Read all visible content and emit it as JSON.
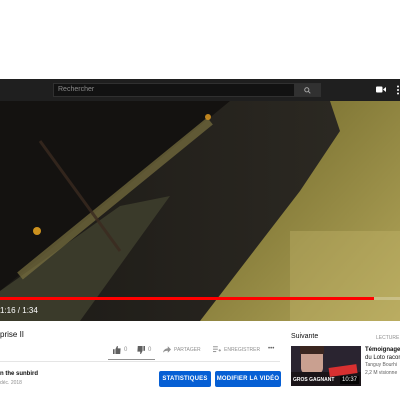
{
  "header": {
    "search_placeholder": "Rechercher",
    "icons": [
      "search-icon",
      "video-camera-icon",
      "more-vertical-icon"
    ]
  },
  "player": {
    "time_display": "1:16 / 1:34",
    "progress_fraction": 0.935,
    "buffered_fraction": 1.0,
    "accent_color": "#ff0000"
  },
  "video_info": {
    "title": "prise II",
    "likes": "0",
    "dislikes": "0",
    "share_label": "PARTAGER",
    "save_label": "ENREGISTRER",
    "more_label": "•••"
  },
  "channel": {
    "name": "n the sunbird",
    "date": "déc. 2018"
  },
  "owner_actions": {
    "stats_label": "STATISTIQUES",
    "edit_label": "MODIFIER LA VIDÉO",
    "button_color": "#065fd4"
  },
  "sidebar": {
    "next_label": "Suivante",
    "autoplay_label": "LECTURE",
    "recommended": {
      "title_line1": "Témoignage",
      "title_line2": "du Loto racon",
      "channel": "Tanguy Bourhi",
      "views": "2,2 M visionne",
      "duration": "10:37",
      "thumb_text": "GROS GAGNANT"
    }
  }
}
